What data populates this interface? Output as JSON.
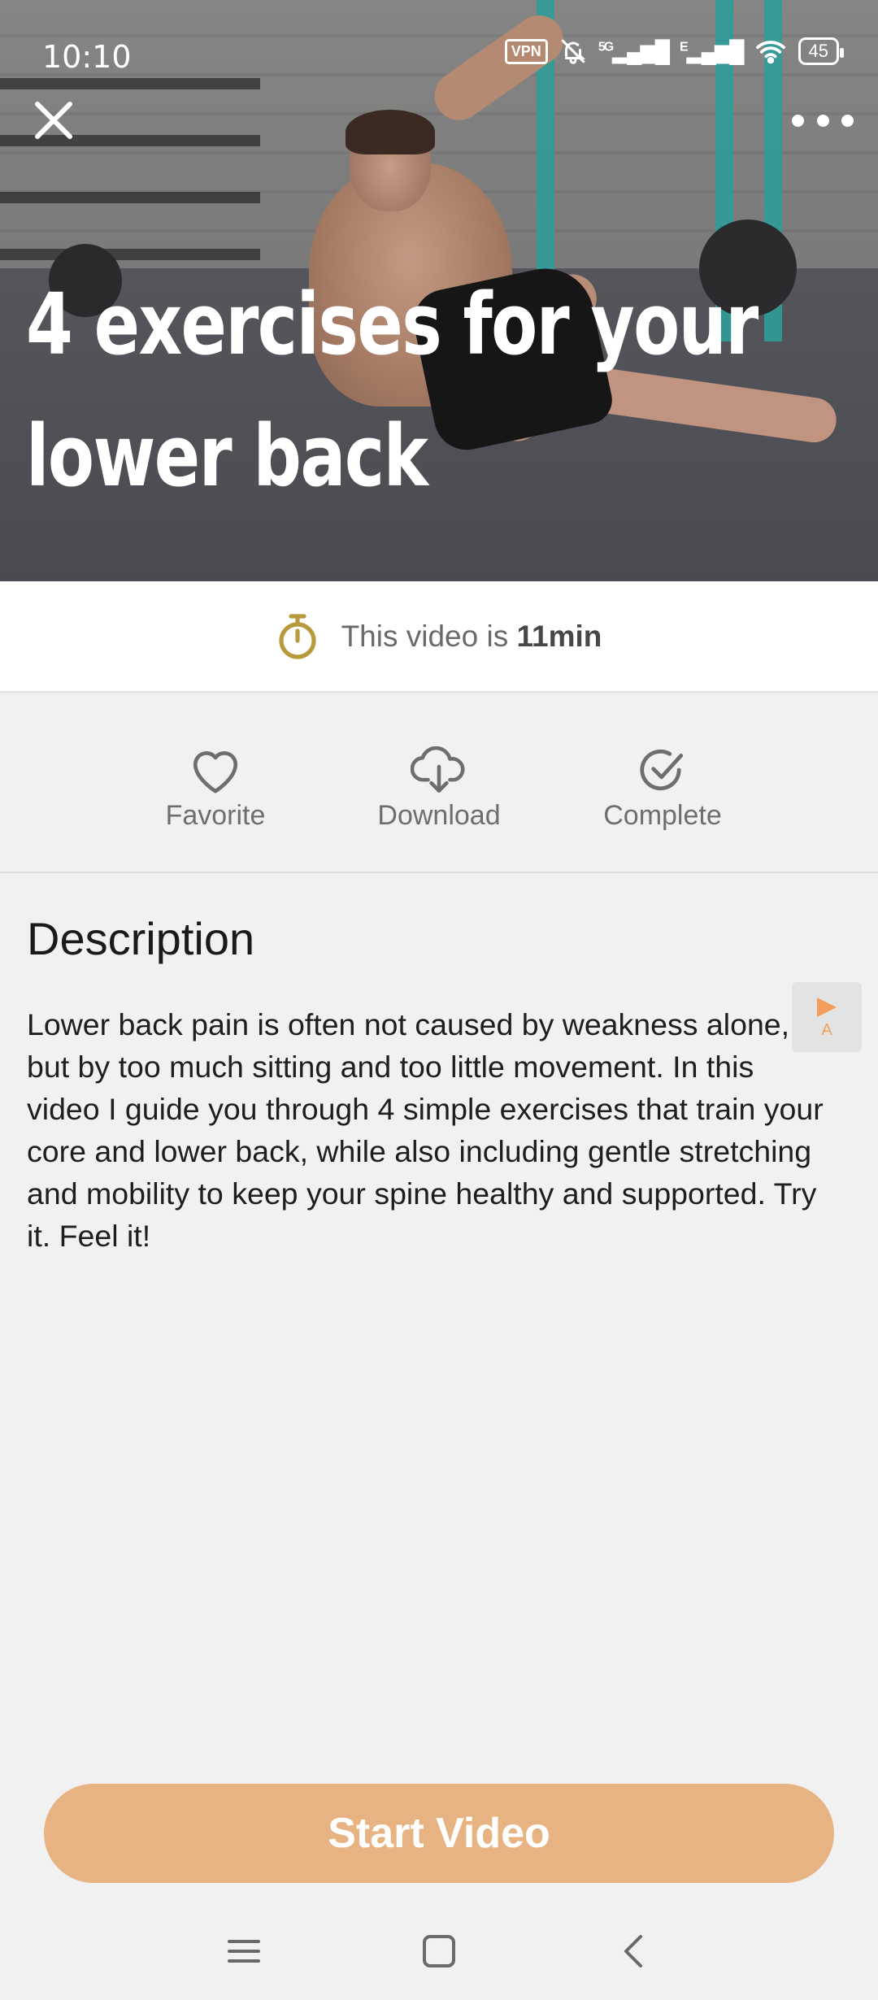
{
  "status_bar": {
    "time": "10:10",
    "vpn_label": "VPN",
    "network_5g": "5G",
    "network_e": "E",
    "battery": "45"
  },
  "hero": {
    "title_line1": "4 exercises for your",
    "title_line2": "lower back"
  },
  "duration": {
    "prefix": "This video is ",
    "value": "11min"
  },
  "actions": {
    "favorite": "Favorite",
    "download": "Download",
    "complete": "Complete"
  },
  "description": {
    "title": "Description",
    "body": "Lower back pain is often not caused by weakness alone, but by too much sitting and too little movement. In this video I guide you through 4 simple exercises that train your core and lower back, while also including gentle stretching and mobility to keep your spine healthy and supported. Try it. Feel it!"
  },
  "translate_button": {
    "letter": "A"
  },
  "start_button": {
    "label": "Start Video"
  },
  "colors": {
    "accent": "#e8b382",
    "timer_icon": "#b89a3e",
    "background": "#f1f1f1"
  }
}
